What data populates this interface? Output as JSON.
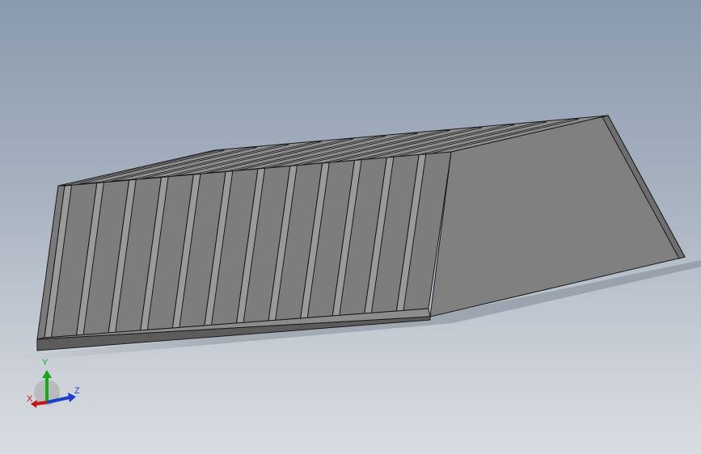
{
  "view": {
    "background_top": "#8a9aae",
    "background_bottom": "#d9dde2",
    "model_face_color": "#808080",
    "model_edge_color": "#1a1a1a"
  },
  "triad": {
    "x_label": "X",
    "y_label": "Y",
    "z_label": "Z",
    "x_color": "#c41818",
    "y_color": "#18a818",
    "z_color": "#1a3fc8"
  }
}
